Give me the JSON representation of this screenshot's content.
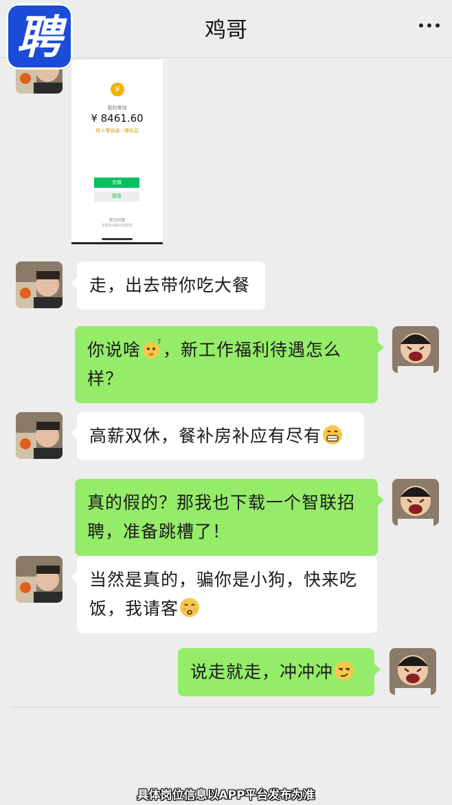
{
  "header": {
    "title": "鸡哥",
    "logo_char": "聘"
  },
  "messages": [
    {
      "side": "left",
      "kind": "image",
      "image": {
        "caption_top": "我的零钱",
        "amount": "¥ 8461.60",
        "caption_mid": "转入零钱通 · 赚收益",
        "button_primary": "充值",
        "button_secondary": "提现",
        "footer1": "常见问题",
        "footer2": "本服务由财付通提供"
      }
    },
    {
      "side": "left",
      "kind": "text",
      "parts": [
        "走，出去带你吃大餐"
      ]
    },
    {
      "side": "right",
      "kind": "text",
      "parts": [
        "你说啥",
        "，新工作福利待遇怎么样？"
      ],
      "emoji": "thinking-emoji"
    },
    {
      "side": "left",
      "kind": "text",
      "parts": [
        "高薪双休，餐补房补应有尽有"
      ],
      "emoji": "grin-emoji"
    },
    {
      "side": "right",
      "kind": "text",
      "parts": [
        "真的假的？那我也下载一个智联招聘，准备跳槽了！"
      ]
    },
    {
      "side": "left",
      "kind": "text",
      "parts": [
        "当然是真的，骗你是小狗，快来吃饭，我请客"
      ],
      "emoji": "kissing-emoji"
    },
    {
      "side": "right",
      "kind": "text",
      "parts": [
        "说走就走，冲冲冲"
      ],
      "emoji": "smirk-emoji"
    }
  ],
  "caption": "具体岗位信息以APP平台发布为准",
  "colors": {
    "background": "#ededed",
    "bubble_green": "#95ec69",
    "bubble_white": "#ffffff",
    "logo_blue": "#1a4bd9"
  }
}
